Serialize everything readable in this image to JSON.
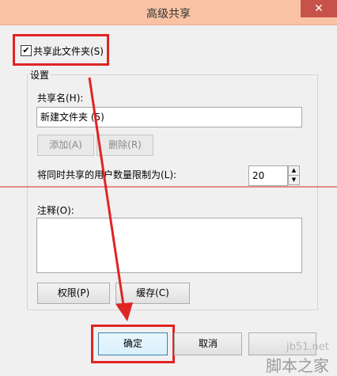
{
  "window": {
    "title": "高级共享",
    "close_glyph": "✕"
  },
  "share_checkbox": {
    "label": "共享此文件夹(S)",
    "checked": true
  },
  "settings": {
    "legend": "设置",
    "share_name_label": "共享名(H):",
    "share_name_value": "新建文件夹 (5)",
    "add_button": "添加(A)",
    "remove_button": "删除(R)",
    "user_limit_label": "将同时共享的用户数量限制为(L):",
    "user_limit_value": "20",
    "comment_label": "注释(O):",
    "comment_value": "",
    "permissions_button": "权限(P)",
    "caching_button": "缓存(C)"
  },
  "footer": {
    "ok_button": "确定",
    "cancel_button": "取消"
  },
  "watermark": {
    "site": "jb51.net",
    "brand": "脚本之家"
  },
  "colors": {
    "annotation": "#e02424",
    "titlebar": "#f9c3a3",
    "close": "#c7524c"
  },
  "icons": [
    "close-icon",
    "checkmark-icon",
    "spinner-up-icon",
    "spinner-down-icon"
  ]
}
